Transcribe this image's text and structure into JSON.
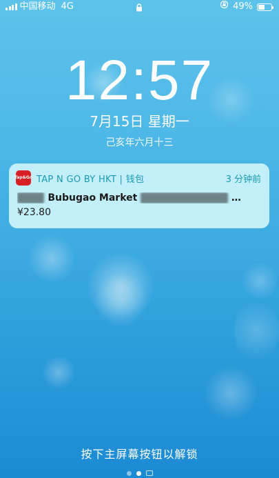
{
  "status_bar": {
    "carrier": "中国移动",
    "network": "4G",
    "battery_percent": "49%",
    "battery_level": 0.49,
    "icons": [
      "signal-icon",
      "lock-icon",
      "orientation-lock-icon",
      "battery-icon"
    ]
  },
  "lockscreen": {
    "time": "12:57",
    "date": "7月15日 星期一",
    "lunar_date": "己亥年六月十三",
    "unlock_hint": "按下主屏幕按钮以解锁",
    "page_dots": 3,
    "active_page": 1
  },
  "notification": {
    "app_name": "TAP N GO BY HKT | 钱包",
    "time_ago": "3 分钟前",
    "title_visible": "Bubugao Market",
    "ellipsis": "…",
    "amount": "¥23.80",
    "app_icon_text": "Tap&Go"
  },
  "colors": {
    "background_top": "#5ec3ea",
    "background_bottom": "#1c8ad3",
    "notification_bg": "#cdf4fc",
    "app_icon": "#d91f26",
    "accent_text": "#1a9ab0"
  }
}
